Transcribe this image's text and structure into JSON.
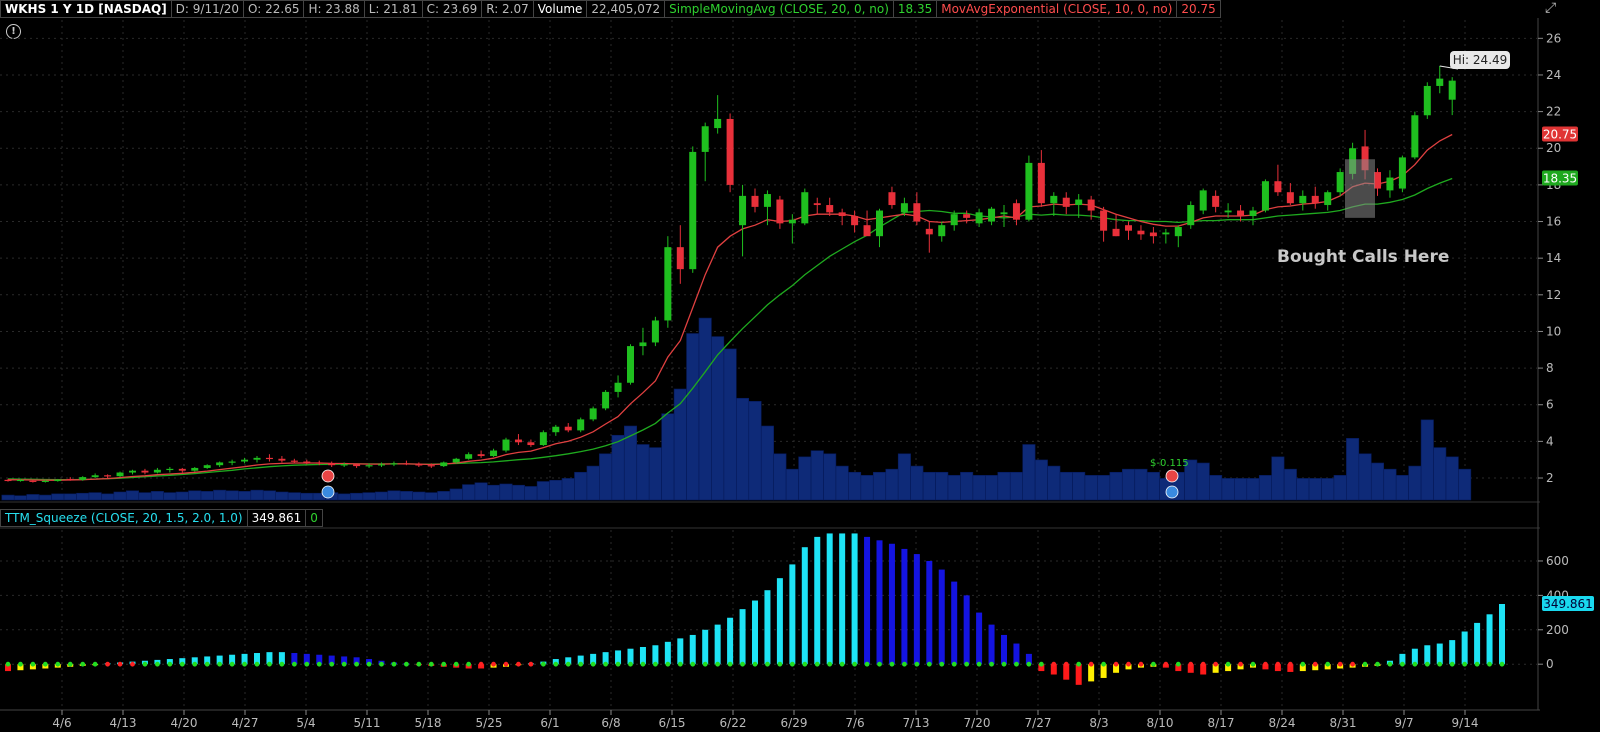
{
  "header": {
    "symbol": "WKHS 1 Y 1D [NASDAQ]",
    "date": "D: 9/11/20",
    "open": "O: 22.65",
    "high": "H: 23.88",
    "low": "L: 21.81",
    "close": "C: 23.69",
    "range": "R: 2.07",
    "volume_label": "Volume",
    "volume_value": "22,405,072",
    "sma_label": "SimpleMovingAvg (CLOSE, 20, 0, no)",
    "sma_value": "18.35",
    "ema_label": "MovAvgExponential (CLOSE, 10, 0, no)",
    "ema_value": "20.75"
  },
  "subheader": {
    "label": "TTM_Squeeze (CLOSE, 20, 1.5, 2.0, 1.0)",
    "value": "349.861",
    "zero": "0"
  },
  "colors": {
    "up": "#1fbf1f",
    "down": "#e8303a",
    "sma": "#1faa1f",
    "ema": "#e04040",
    "volume": "#0e2a78",
    "mom_cyan": "#1ee3f5",
    "mom_blue": "#1414e0",
    "mom_red": "#ff1a1a",
    "mom_yellow": "#ffee00",
    "dot_green": "#22dd22",
    "dot_red": "#ff2222"
  },
  "annotations": {
    "hi_label": "Hi: 24.49",
    "bought_label": "Bought Calls Here",
    "earnings_label": "$-0.115",
    "ema_tag": "20.75",
    "sma_tag": "18.35",
    "squeeze_tag": "349.861"
  },
  "chart_data": [
    {
      "type": "candlestick",
      "title": "WKHS 1 Y 1D [NASDAQ]",
      "y_ticks": [
        2,
        4,
        6,
        8,
        10,
        12,
        14,
        16,
        18,
        20,
        22,
        24,
        26
      ],
      "ylim": [
        0.8,
        27
      ],
      "x_labels": [
        "4/6",
        "4/13",
        "4/20",
        "4/27",
        "5/4",
        "5/11",
        "5/18",
        "5/25",
        "6/1",
        "6/8",
        "6/15",
        "6/22",
        "6/29",
        "7/6",
        "7/13",
        "7/20",
        "7/27",
        "8/3",
        "8/10",
        "8/17",
        "8/24",
        "8/31",
        "9/7",
        "9/14"
      ],
      "ohlc": [
        [
          1.9,
          1.95,
          1.8,
          1.85
        ],
        [
          1.85,
          1.95,
          1.8,
          1.9
        ],
        [
          1.85,
          1.9,
          1.75,
          1.8
        ],
        [
          1.8,
          1.9,
          1.75,
          1.85
        ],
        [
          1.85,
          1.95,
          1.8,
          1.9
        ],
        [
          1.95,
          2.05,
          1.85,
          1.9
        ],
        [
          1.9,
          2.1,
          1.85,
          2.05
        ],
        [
          2.05,
          2.25,
          2.0,
          2.15
        ],
        [
          2.15,
          2.2,
          2.0,
          2.1
        ],
        [
          2.1,
          2.35,
          2.05,
          2.3
        ],
        [
          2.3,
          2.45,
          2.2,
          2.4
        ],
        [
          2.4,
          2.5,
          2.2,
          2.3
        ],
        [
          2.3,
          2.55,
          2.25,
          2.45
        ],
        [
          2.45,
          2.6,
          2.3,
          2.5
        ],
        [
          2.5,
          2.55,
          2.3,
          2.4
        ],
        [
          2.4,
          2.6,
          2.35,
          2.55
        ],
        [
          2.55,
          2.75,
          2.5,
          2.7
        ],
        [
          2.7,
          2.9,
          2.6,
          2.85
        ],
        [
          2.85,
          3.0,
          2.7,
          2.9
        ],
        [
          2.9,
          3.1,
          2.8,
          3.0
        ],
        [
          3.0,
          3.2,
          2.85,
          3.1
        ],
        [
          3.1,
          3.3,
          2.9,
          3.05
        ],
        [
          3.05,
          3.2,
          2.85,
          2.95
        ],
        [
          2.95,
          3.05,
          2.8,
          2.9
        ],
        [
          2.9,
          3.0,
          2.75,
          2.85
        ],
        [
          2.85,
          2.95,
          2.7,
          2.8
        ],
        [
          2.8,
          2.9,
          2.6,
          2.7
        ],
        [
          2.7,
          2.85,
          2.6,
          2.75
        ],
        [
          2.75,
          2.8,
          2.55,
          2.65
        ],
        [
          2.65,
          2.8,
          2.55,
          2.7
        ],
        [
          2.7,
          2.85,
          2.6,
          2.75
        ],
        [
          2.75,
          2.9,
          2.65,
          2.8
        ],
        [
          2.8,
          2.95,
          2.7,
          2.75
        ],
        [
          2.75,
          2.85,
          2.6,
          2.7
        ],
        [
          2.7,
          2.8,
          2.55,
          2.65
        ],
        [
          2.65,
          2.9,
          2.6,
          2.85
        ],
        [
          2.85,
          3.1,
          2.8,
          3.05
        ],
        [
          3.05,
          3.4,
          3.0,
          3.3
        ],
        [
          3.3,
          3.5,
          3.1,
          3.2
        ],
        [
          3.2,
          3.6,
          3.15,
          3.5
        ],
        [
          3.5,
          4.2,
          3.4,
          4.1
        ],
        [
          4.1,
          4.4,
          3.8,
          3.95
        ],
        [
          3.95,
          4.1,
          3.7,
          3.8
        ],
        [
          3.8,
          4.6,
          3.75,
          4.5
        ],
        [
          4.5,
          4.9,
          4.3,
          4.8
        ],
        [
          4.8,
          5.0,
          4.5,
          4.6
        ],
        [
          4.6,
          5.3,
          4.5,
          5.2
        ],
        [
          5.2,
          5.9,
          5.1,
          5.8
        ],
        [
          5.8,
          6.8,
          5.7,
          6.7
        ],
        [
          6.7,
          7.6,
          6.4,
          7.2
        ],
        [
          7.2,
          9.3,
          7.1,
          9.2
        ],
        [
          9.2,
          10.2,
          8.7,
          9.4
        ],
        [
          9.4,
          10.8,
          9.2,
          10.6
        ],
        [
          10.6,
          15.2,
          10.2,
          14.6
        ],
        [
          14.6,
          15.8,
          12.6,
          13.4
        ],
        [
          13.4,
          20.1,
          13.2,
          19.8
        ],
        [
          19.8,
          21.4,
          18.2,
          21.2
        ],
        [
          21.1,
          22.9,
          20.8,
          21.6
        ],
        [
          21.6,
          21.9,
          17.6,
          18.0
        ],
        [
          15.8,
          18.0,
          14.1,
          17.4
        ],
        [
          17.4,
          17.8,
          16.5,
          16.8
        ],
        [
          16.8,
          17.7,
          15.8,
          17.5
        ],
        [
          17.2,
          17.4,
          15.6,
          15.9
        ],
        [
          15.9,
          16.4,
          14.8,
          16.1
        ],
        [
          15.9,
          17.8,
          15.8,
          17.6
        ],
        [
          17.0,
          17.3,
          16.4,
          16.9
        ],
        [
          16.9,
          17.3,
          16.3,
          16.5
        ],
        [
          16.5,
          16.7,
          15.8,
          16.3
        ],
        [
          16.3,
          16.6,
          15.4,
          15.8
        ],
        [
          15.8,
          16.6,
          15.3,
          15.2
        ],
        [
          15.2,
          16.7,
          14.6,
          16.6
        ],
        [
          17.6,
          17.9,
          16.7,
          16.9
        ],
        [
          16.5,
          17.3,
          16.3,
          17.0
        ],
        [
          17.0,
          17.6,
          15.8,
          16.0
        ],
        [
          15.6,
          16.0,
          14.3,
          15.3
        ],
        [
          15.2,
          16.0,
          14.9,
          15.8
        ],
        [
          15.8,
          16.6,
          15.5,
          16.4
        ],
        [
          16.4,
          16.6,
          15.9,
          16.2
        ],
        [
          15.9,
          16.7,
          15.7,
          16.5
        ],
        [
          16.0,
          16.8,
          15.8,
          16.7
        ],
        [
          16.4,
          16.9,
          15.7,
          16.5
        ],
        [
          17.0,
          17.2,
          15.8,
          16.1
        ],
        [
          16.1,
          19.6,
          16.0,
          19.2
        ],
        [
          19.2,
          19.9,
          16.8,
          17.0
        ],
        [
          17.0,
          17.6,
          16.3,
          17.4
        ],
        [
          17.3,
          17.6,
          16.4,
          16.8
        ],
        [
          16.9,
          17.5,
          16.2,
          17.2
        ],
        [
          17.2,
          17.4,
          16.1,
          16.6
        ],
        [
          16.6,
          16.8,
          14.9,
          15.5
        ],
        [
          15.6,
          16.4,
          15.2,
          15.2
        ],
        [
          15.8,
          16.0,
          15.0,
          15.5
        ],
        [
          15.5,
          15.8,
          15.0,
          15.3
        ],
        [
          15.4,
          15.7,
          14.8,
          15.2
        ],
        [
          15.3,
          15.6,
          14.8,
          15.4
        ],
        [
          15.2,
          15.8,
          14.6,
          15.7
        ],
        [
          15.8,
          17.1,
          15.6,
          16.9
        ],
        [
          16.6,
          17.8,
          16.4,
          17.7
        ],
        [
          17.4,
          17.7,
          16.5,
          16.8
        ],
        [
          16.5,
          17.0,
          16.2,
          16.6
        ],
        [
          16.6,
          16.9,
          16.0,
          16.3
        ],
        [
          16.3,
          16.8,
          15.8,
          16.6
        ],
        [
          16.6,
          18.3,
          16.5,
          18.2
        ],
        [
          18.2,
          19.1,
          17.4,
          17.6
        ],
        [
          17.6,
          18.1,
          16.9,
          17.0
        ],
        [
          17.0,
          17.7,
          16.6,
          17.4
        ],
        [
          17.4,
          17.9,
          16.7,
          17.0
        ],
        [
          16.9,
          17.7,
          16.6,
          17.6
        ],
        [
          17.6,
          18.9,
          17.4,
          18.7
        ],
        [
          18.6,
          20.3,
          18.3,
          20.0
        ],
        [
          20.1,
          21.0,
          18.3,
          18.8
        ],
        [
          18.7,
          18.9,
          17.4,
          17.8
        ],
        [
          17.7,
          18.8,
          17.3,
          18.4
        ],
        [
          17.8,
          19.6,
          17.6,
          19.5
        ],
        [
          19.5,
          22.0,
          19.4,
          21.8
        ],
        [
          21.8,
          23.6,
          21.6,
          23.4
        ],
        [
          23.4,
          24.49,
          23.0,
          23.8
        ],
        [
          22.65,
          23.88,
          21.81,
          23.69
        ]
      ],
      "volume_millions": [
        0.8,
        0.7,
        0.9,
        0.8,
        1.0,
        1.0,
        1.1,
        1.2,
        1.0,
        1.3,
        1.5,
        1.2,
        1.4,
        1.2,
        1.3,
        1.5,
        1.4,
        1.6,
        1.5,
        1.4,
        1.6,
        1.5,
        1.3,
        1.2,
        1.1,
        1.1,
        1.2,
        1.0,
        1.1,
        1.2,
        1.3,
        1.5,
        1.4,
        1.3,
        1.2,
        1.4,
        1.8,
        2.5,
        2.8,
        2.4,
        2.6,
        2.4,
        2.2,
        3.0,
        3.2,
        3.5,
        4.5,
        5.5,
        7.5,
        10.5,
        12.0,
        9.0,
        8.5,
        14.0,
        18.0,
        27.0,
        29.5,
        26.5,
        24.5,
        16.5,
        16.0,
        12.0,
        7.5,
        5.0,
        7.0,
        8.0,
        7.5,
        5.5,
        4.5,
        4.0,
        4.5,
        5.0,
        7.5,
        5.5,
        4.5,
        4.5,
        4.0,
        4.5,
        4.0,
        4.0,
        4.5,
        4.5,
        9.0,
        6.5,
        5.5,
        4.5,
        4.5,
        4.0,
        4.0,
        4.5,
        5.0,
        5.0,
        4.5,
        3.5,
        4.5,
        6.5,
        6.0,
        4.0,
        3.5,
        3.5,
        3.5,
        4.0,
        7.0,
        5.0,
        3.5,
        3.5,
        3.5,
        4.0,
        10.0,
        7.5,
        6.0,
        5.0,
        4.0,
        5.5,
        13.0,
        8.5,
        7.0,
        5.0
      ],
      "sma_20": [
        1.95,
        1.94,
        1.93,
        1.92,
        1.91,
        1.91,
        1.92,
        1.94,
        1.96,
        1.99,
        2.03,
        2.07,
        2.11,
        2.15,
        2.19,
        2.24,
        2.3,
        2.36,
        2.42,
        2.5,
        2.56,
        2.62,
        2.66,
        2.7,
        2.72,
        2.74,
        2.75,
        2.76,
        2.77,
        2.77,
        2.77,
        2.77,
        2.77,
        2.76,
        2.76,
        2.77,
        2.79,
        2.82,
        2.84,
        2.88,
        2.94,
        3.0,
        3.05,
        3.13,
        3.22,
        3.32,
        3.44,
        3.58,
        3.76,
        3.98,
        4.3,
        4.62,
        4.98,
        5.55,
        6.06,
        6.9,
        7.8,
        8.72,
        9.45,
        10.15,
        10.8,
        11.45,
        12.0,
        12.5,
        13.1,
        13.6,
        14.1,
        14.5,
        14.9,
        15.25,
        15.7,
        16.1,
        16.5,
        16.55,
        16.6,
        16.55,
        16.45,
        16.45,
        16.3,
        16.25,
        16.2,
        16.25,
        16.4,
        16.35,
        16.4,
        16.35,
        16.35,
        16.3,
        16.2,
        16.1,
        16.05,
        16.05,
        16.0,
        16.0,
        15.95,
        16.0,
        16.05,
        16.05,
        16.1,
        16.1,
        16.1,
        16.2,
        16.3,
        16.35,
        16.4,
        16.45,
        16.5,
        16.6,
        16.8,
        16.95,
        16.95,
        17.05,
        17.2,
        17.45,
        17.8,
        18.1,
        18.35
      ],
      "ema_10": [
        1.9,
        1.9,
        1.89,
        1.88,
        1.88,
        1.89,
        1.91,
        1.94,
        1.97,
        2.02,
        2.08,
        2.12,
        2.18,
        2.22,
        2.26,
        2.31,
        2.38,
        2.46,
        2.54,
        2.62,
        2.71,
        2.77,
        2.8,
        2.82,
        2.82,
        2.82,
        2.8,
        2.79,
        2.77,
        2.76,
        2.76,
        2.77,
        2.77,
        2.76,
        2.74,
        2.76,
        2.82,
        2.91,
        2.98,
        3.08,
        3.28,
        3.4,
        3.47,
        3.66,
        3.87,
        4.01,
        4.23,
        4.52,
        4.95,
        5.35,
        6.05,
        6.65,
        7.3,
        8.6,
        9.5,
        11.3,
        13.1,
        14.6,
        15.2,
        15.6,
        15.8,
        16.1,
        16.0,
        16.05,
        16.3,
        16.4,
        16.4,
        16.4,
        16.3,
        16.1,
        16.2,
        16.3,
        16.4,
        16.3,
        16.0,
        15.95,
        16.0,
        16.05,
        16.1,
        16.2,
        16.3,
        16.2,
        16.8,
        16.85,
        16.95,
        16.9,
        16.95,
        16.9,
        16.65,
        16.4,
        16.2,
        16.0,
        15.85,
        15.75,
        15.75,
        15.95,
        16.2,
        16.3,
        16.3,
        16.3,
        16.35,
        16.65,
        16.8,
        16.85,
        16.95,
        17.0,
        17.1,
        17.4,
        17.9,
        18.1,
        18.05,
        18.2,
        18.5,
        19.1,
        19.9,
        20.4,
        20.75
      ],
      "price_tags": [
        20.75,
        18.35
      ]
    },
    {
      "type": "bar",
      "title": "TTM_Squeeze (CLOSE, 20, 1.5, 2.0, 1.0)",
      "y_ticks": [
        0,
        200,
        400,
        600
      ],
      "ylim": [
        -150,
        780
      ],
      "momentum": [
        -40,
        -35,
        -30,
        -25,
        -20,
        -15,
        -10,
        -5,
        5,
        10,
        15,
        20,
        25,
        30,
        35,
        40,
        45,
        50,
        55,
        60,
        65,
        70,
        70,
        65,
        60,
        55,
        50,
        45,
        40,
        30,
        20,
        10,
        5,
        -5,
        -10,
        -15,
        -20,
        -25,
        -25,
        -20,
        -15,
        -5,
        5,
        15,
        30,
        40,
        50,
        60,
        70,
        80,
        90,
        100,
        110,
        130,
        150,
        170,
        200,
        230,
        270,
        320,
        370,
        430,
        500,
        580,
        680,
        740,
        760,
        760,
        760,
        740,
        720,
        700,
        670,
        640,
        600,
        550,
        480,
        400,
        300,
        230,
        170,
        120,
        60,
        -40,
        -60,
        -90,
        -120,
        -100,
        -80,
        -50,
        -30,
        -20,
        -15,
        -20,
        -40,
        -50,
        -60,
        -50,
        -40,
        -30,
        -20,
        -30,
        -40,
        -45,
        -40,
        -35,
        -30,
        -25,
        -20,
        -15,
        -10,
        20,
        60,
        90,
        110,
        120,
        140,
        190,
        240,
        290,
        349.861
      ],
      "squeeze_dots": "green=no squeeze, red=squeeze on"
    }
  ]
}
